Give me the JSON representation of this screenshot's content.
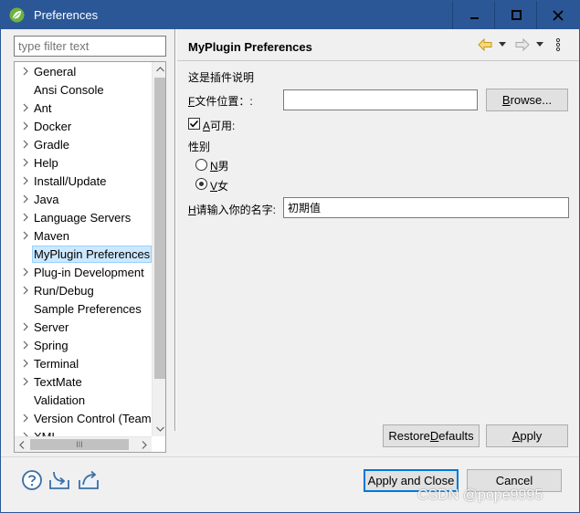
{
  "window": {
    "title": "Preferences",
    "minimize_glyph": "—",
    "maximize_glyph": "☐",
    "close_glyph": "✕",
    "titlebar_color": "#2b5797"
  },
  "filter": {
    "placeholder": "type filter text"
  },
  "tree": {
    "items": [
      {
        "label": "General",
        "expandable": true
      },
      {
        "label": "Ansi Console",
        "expandable": false
      },
      {
        "label": "Ant",
        "expandable": true
      },
      {
        "label": "Docker",
        "expandable": true
      },
      {
        "label": "Gradle",
        "expandable": true
      },
      {
        "label": "Help",
        "expandable": true
      },
      {
        "label": "Install/Update",
        "expandable": true
      },
      {
        "label": "Java",
        "expandable": true
      },
      {
        "label": "Language Servers",
        "expandable": true
      },
      {
        "label": "Maven",
        "expandable": true
      },
      {
        "label": "MyPlugin Preferences",
        "expandable": false,
        "selected": true
      },
      {
        "label": "Plug-in Development",
        "expandable": true
      },
      {
        "label": "Run/Debug",
        "expandable": true
      },
      {
        "label": "Sample Preferences",
        "expandable": false
      },
      {
        "label": "Server",
        "expandable": true
      },
      {
        "label": "Spring",
        "expandable": true
      },
      {
        "label": "Terminal",
        "expandable": true
      },
      {
        "label": "TextMate",
        "expandable": true
      },
      {
        "label": "Validation",
        "expandable": false
      },
      {
        "label": "Version Control (Team)",
        "expandable": true
      },
      {
        "label": "XML",
        "expandable": true
      }
    ],
    "hscroll_thumb_glyph": "III"
  },
  "page": {
    "title": "MyPlugin Preferences",
    "description": "这是插件说明",
    "file_label": {
      "mnemonic": "F",
      "rest": "文件位置：:"
    },
    "file_value": "",
    "browse_button": {
      "mnemonic": "B",
      "rest": "rowse..."
    },
    "enabled_checkbox": {
      "mnemonic": "A",
      "rest": "可用:",
      "checked": true
    },
    "gender_group_label": "性别",
    "radio_options": [
      {
        "mnemonic": "N",
        "rest": "男",
        "checked": false
      },
      {
        "mnemonic": "V",
        "rest": "女",
        "checked": true
      }
    ],
    "name_label": {
      "mnemonic": "H",
      "rest": "请输入你的名字:"
    },
    "name_value": "初期值",
    "restore_defaults_button": {
      "pre": "Restore ",
      "mnemonic": "D",
      "rest": "efaults"
    },
    "apply_button": {
      "mnemonic": "A",
      "rest": "pply"
    }
  },
  "footer": {
    "apply_close_button": "Apply and Close",
    "cancel_button": "Cancel",
    "help_icon": "help-icon",
    "import_icon": "import-icon",
    "export_icon": "export-icon"
  },
  "watermark": "CSDN @pope9995"
}
